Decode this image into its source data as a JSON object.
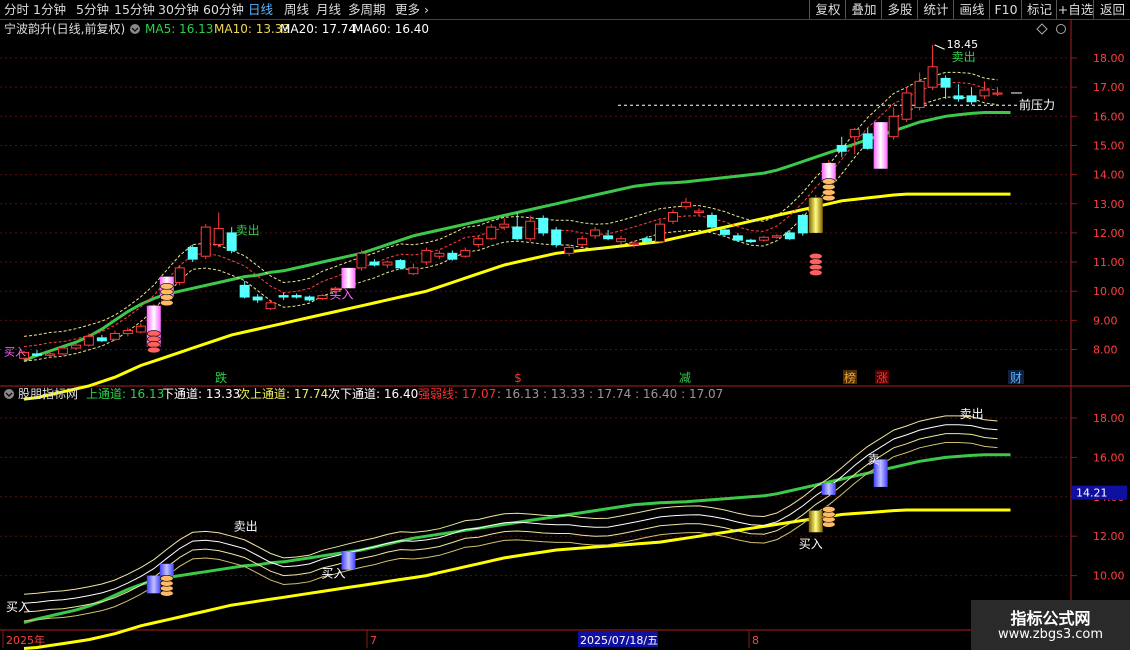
{
  "toolbar": {
    "periods": [
      "分时",
      "1分钟",
      "5分钟",
      "15分钟",
      "30分钟",
      "60分钟",
      "日线",
      "周线",
      "月线",
      "多周期",
      "更多"
    ],
    "active_period": "日线",
    "right_buttons": [
      "复权",
      "叠加",
      "多股",
      "统计",
      "画线",
      "F10",
      "标记",
      "+自选",
      "返回"
    ]
  },
  "top_panel": {
    "title": "宁波韵升(日线,前复权)",
    "ma": [
      {
        "label": "MA5: 16.13",
        "color": "#2bd14a"
      },
      {
        "label": "MA10: 13.33",
        "color": "#f0d850"
      },
      {
        "label": "MA20: 17.74",
        "color": "#ffffff"
      },
      {
        "label": "MA60: 16.40",
        "color": "#ffffff"
      }
    ],
    "y_ticks": [
      "18.00",
      "17.00",
      "16.00",
      "15.00",
      "14.00",
      "13.00",
      "12.00",
      "11.00",
      "10.00",
      "9.00",
      "8.00"
    ],
    "high_label": "18.45",
    "pressure_label": "前压力",
    "signals": {
      "buy": "买入",
      "sell": "卖出"
    },
    "event_markers": [
      {
        "text": "跌",
        "color": "#2bd14a"
      },
      {
        "text": "$",
        "color": "#ff3030"
      },
      {
        "text": "减",
        "color": "#2bd14a"
      },
      {
        "text": "榜",
        "color": "#e8a040"
      },
      {
        "text": "涨",
        "color": "#ff3030"
      },
      {
        "text": "财",
        "color": "#5ab4ff"
      }
    ]
  },
  "bottom_panel": {
    "title": "股朋指标网",
    "items": [
      {
        "text": "上通道: 16.13",
        "color": "#2bd14a"
      },
      {
        "text": "下通道: 13.33",
        "color": "#ffffff"
      },
      {
        "text": "次上通道: 17.74",
        "color": "#f0f060"
      },
      {
        "text": "次下通道: 16.40",
        "color": "#ffffff"
      },
      {
        "text": "强弱线: 17.07",
        "color": "#ff3030"
      },
      {
        "text": ": 16.13 : 13.33 : 17.74 : 16.40 : 17.07",
        "color": "#9a9a9a"
      }
    ],
    "y_ticks": [
      "18.00",
      "16.00",
      "14.00",
      "12.00",
      "10.00"
    ],
    "cursor_value": "14.21",
    "signals": {
      "buy": "买入",
      "sell": "卖出"
    }
  },
  "time_axis": {
    "labels": [
      "2025年",
      "7",
      "2025/07/18/五",
      "8"
    ]
  },
  "watermark": {
    "line1": "指标公式网",
    "line2": "www.zbgs3.com"
  },
  "chart_data": {
    "type": "candlestick",
    "title": "宁波韵升(日线,前复权)",
    "ylim": [
      7.4,
      18.8
    ],
    "candles": [
      [
        7.7,
        7.9,
        7.62,
        7.95
      ],
      [
        7.85,
        7.8,
        7.75,
        7.98
      ],
      [
        7.8,
        7.85,
        7.7,
        7.92
      ],
      [
        7.85,
        8.05,
        7.8,
        8.1
      ],
      [
        8.05,
        8.15,
        7.98,
        8.22
      ],
      [
        8.15,
        8.45,
        8.1,
        8.55
      ],
      [
        8.4,
        8.3,
        8.25,
        8.5
      ],
      [
        8.35,
        8.55,
        8.3,
        8.65
      ],
      [
        8.55,
        8.65,
        8.45,
        8.75
      ],
      [
        8.6,
        8.8,
        8.55,
        8.9
      ],
      [
        8.9,
        9.5,
        8.85,
        9.55
      ],
      [
        9.6,
        10.2,
        9.55,
        10.3
      ],
      [
        10.3,
        10.8,
        10.2,
        10.9
      ],
      [
        11.5,
        11.1,
        11.0,
        11.6
      ],
      [
        11.2,
        12.2,
        11.1,
        12.3
      ],
      [
        11.6,
        12.15,
        11.5,
        12.7
      ],
      [
        12.0,
        11.4,
        11.3,
        12.2
      ],
      [
        10.2,
        9.8,
        9.75,
        10.35
      ],
      [
        9.8,
        9.7,
        9.6,
        9.9
      ],
      [
        9.4,
        9.6,
        9.35,
        9.7
      ],
      [
        9.85,
        9.8,
        9.7,
        9.95
      ],
      [
        9.85,
        9.8,
        9.75,
        9.92
      ],
      [
        9.8,
        9.7,
        9.65,
        9.85
      ],
      [
        9.75,
        9.85,
        9.7,
        9.9
      ],
      [
        10.0,
        10.1,
        9.95,
        10.15
      ],
      [
        10.6,
        10.4,
        10.3,
        10.7
      ],
      [
        10.8,
        11.3,
        10.7,
        11.4
      ],
      [
        11.0,
        10.9,
        10.85,
        11.1
      ],
      [
        10.9,
        11.0,
        10.8,
        11.05
      ],
      [
        11.05,
        10.8,
        10.75,
        11.1
      ],
      [
        10.6,
        10.8,
        10.55,
        10.95
      ],
      [
        11.0,
        11.4,
        10.9,
        11.5
      ],
      [
        11.2,
        11.3,
        11.1,
        11.4
      ],
      [
        11.3,
        11.1,
        11.05,
        11.4
      ],
      [
        11.2,
        11.4,
        11.15,
        11.5
      ],
      [
        11.6,
        11.8,
        11.5,
        11.9
      ],
      [
        11.8,
        12.2,
        11.75,
        12.3
      ],
      [
        12.2,
        12.3,
        12.1,
        12.5
      ],
      [
        12.2,
        11.8,
        11.75,
        12.7
      ],
      [
        11.8,
        12.4,
        11.7,
        12.6
      ],
      [
        12.5,
        12.0,
        11.9,
        12.6
      ],
      [
        12.1,
        11.6,
        11.5,
        12.2
      ],
      [
        11.3,
        11.5,
        11.2,
        11.6
      ],
      [
        11.6,
        11.8,
        11.5,
        11.9
      ],
      [
        11.9,
        12.1,
        11.8,
        12.2
      ],
      [
        11.9,
        11.8,
        11.75,
        12.1
      ],
      [
        11.7,
        11.8,
        11.6,
        11.9
      ],
      [
        11.6,
        11.65,
        11.5,
        11.7
      ],
      [
        11.8,
        11.7,
        11.65,
        11.9
      ],
      [
        11.7,
        12.3,
        11.65,
        12.45
      ],
      [
        12.4,
        12.7,
        12.3,
        12.8
      ],
      [
        12.9,
        13.05,
        12.8,
        13.2
      ],
      [
        12.7,
        12.75,
        12.6,
        12.85
      ],
      [
        12.6,
        12.2,
        12.15,
        12.7
      ],
      [
        12.1,
        11.95,
        11.9,
        12.2
      ],
      [
        11.9,
        11.75,
        11.7,
        12.0
      ],
      [
        11.75,
        11.7,
        11.65,
        11.8
      ],
      [
        11.75,
        11.85,
        11.7,
        11.9
      ],
      [
        11.85,
        11.9,
        11.8,
        11.95
      ],
      [
        12.0,
        11.8,
        11.75,
        12.1
      ],
      [
        12.6,
        12.0,
        11.9,
        12.65
      ],
      [
        13.0,
        13.2,
        12.9,
        13.3
      ],
      [
        13.8,
        14.3,
        13.7,
        14.5
      ],
      [
        15.0,
        14.8,
        14.6,
        15.3
      ],
      [
        15.3,
        15.55,
        14.7,
        15.6
      ],
      [
        15.4,
        14.9,
        14.85,
        15.6
      ],
      [
        14.5,
        15.5,
        14.4,
        15.7
      ],
      [
        15.3,
        16.0,
        15.2,
        16.3
      ],
      [
        15.9,
        16.8,
        15.8,
        17.0
      ],
      [
        16.3,
        17.2,
        16.2,
        17.5
      ],
      [
        17.0,
        17.7,
        16.9,
        18.45
      ],
      [
        17.3,
        17.0,
        16.6,
        17.4
      ],
      [
        16.7,
        16.6,
        16.5,
        17.1
      ],
      [
        16.7,
        16.5,
        16.4,
        17.0
      ],
      [
        16.7,
        16.9,
        16.6,
        17.2
      ],
      [
        16.8,
        16.8,
        16.7,
        17.0
      ]
    ],
    "series": [
      {
        "name": "上通道",
        "values": [
          7.62,
          7.8,
          7.95,
          8.1,
          8.25,
          8.45,
          8.7,
          9.0,
          9.3,
          9.55,
          9.75,
          9.9,
          10.0,
          10.1,
          10.2,
          10.3,
          10.4,
          10.5,
          10.55,
          10.65,
          10.7,
          10.8,
          10.9,
          11.0,
          11.1,
          11.2,
          11.3,
          11.45,
          11.6,
          11.75,
          11.9,
          12.0,
          12.1,
          12.2,
          12.3,
          12.4,
          12.5,
          12.6,
          12.7,
          12.8,
          12.9,
          13.0,
          13.1,
          13.2,
          13.3,
          13.4,
          13.5,
          13.6,
          13.65,
          13.7,
          13.72,
          13.75,
          13.8,
          13.85,
          13.9,
          13.95,
          14.0,
          14.05,
          14.15,
          14.3,
          14.45,
          14.6,
          14.75,
          14.9,
          15.05,
          15.2,
          15.35,
          15.5,
          15.65,
          15.8,
          15.9,
          16.0,
          16.05,
          16.1,
          16.13,
          16.13,
          16.13
        ]
      },
      {
        "name": "下通道",
        "values": [
          6.3,
          6.35,
          6.45,
          6.55,
          6.65,
          6.75,
          6.9,
          7.05,
          7.25,
          7.45,
          7.6,
          7.75,
          7.9,
          8.05,
          8.2,
          8.35,
          8.5,
          8.6,
          8.7,
          8.8,
          8.9,
          9.0,
          9.1,
          9.2,
          9.3,
          9.4,
          9.5,
          9.6,
          9.7,
          9.8,
          9.9,
          10.0,
          10.15,
          10.3,
          10.45,
          10.6,
          10.75,
          10.9,
          11.0,
          11.1,
          11.2,
          11.3,
          11.35,
          11.4,
          11.45,
          11.5,
          11.55,
          11.6,
          11.65,
          11.7,
          11.8,
          11.9,
          12.0,
          12.1,
          12.2,
          12.3,
          12.4,
          12.5,
          12.6,
          12.7,
          12.8,
          12.9,
          13.0,
          13.1,
          13.15,
          13.2,
          13.25,
          13.3,
          13.33,
          13.33,
          13.33,
          13.33,
          13.33,
          13.33,
          13.33,
          13.33,
          13.33
        ]
      }
    ],
    "indicator_values": {
      "上通道": 16.13,
      "下通道": 13.33,
      "次上通道": 17.74,
      "次下通道": 16.4,
      "强弱线": 17.07
    }
  }
}
